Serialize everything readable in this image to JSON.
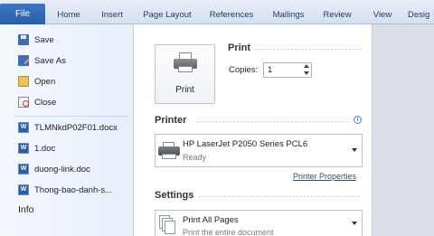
{
  "ribbon": {
    "file_tab": "File",
    "tabs": [
      "Home",
      "Insert",
      "Page Layout",
      "References",
      "Mailings",
      "Review",
      "View",
      "Desig"
    ]
  },
  "backstage": {
    "items": [
      {
        "label": "Save",
        "icon": "save-icon"
      },
      {
        "label": "Save As",
        "icon": "save-as-icon"
      },
      {
        "label": "Open",
        "icon": "open-folder-icon"
      },
      {
        "label": "Close",
        "icon": "close-document-icon"
      }
    ],
    "recent": [
      {
        "label": "TLMNkdP02F01.docx",
        "icon": "word-document-icon"
      },
      {
        "label": "1.doc",
        "icon": "word-document-icon"
      },
      {
        "label": "duong-link.doc",
        "icon": "word-document-icon"
      },
      {
        "label": "Thong-bao-danh-s...",
        "icon": "word-document-icon"
      }
    ],
    "info": "Info"
  },
  "print": {
    "heading": "Print",
    "button_label": "Print",
    "copies_label": "Copies:",
    "copies_value": "1"
  },
  "printer": {
    "heading": "Printer",
    "name": "HP LaserJet P2050 Series PCL6",
    "status": "Ready",
    "properties_link": "Printer Properties"
  },
  "settings": {
    "heading": "Settings",
    "pages_title": "Print All Pages",
    "pages_sub": "Print the entire document"
  },
  "colors": {
    "file_tab": "#2a5ea8",
    "ribbon_text": "#1e395b",
    "link": "#2a4f85"
  }
}
